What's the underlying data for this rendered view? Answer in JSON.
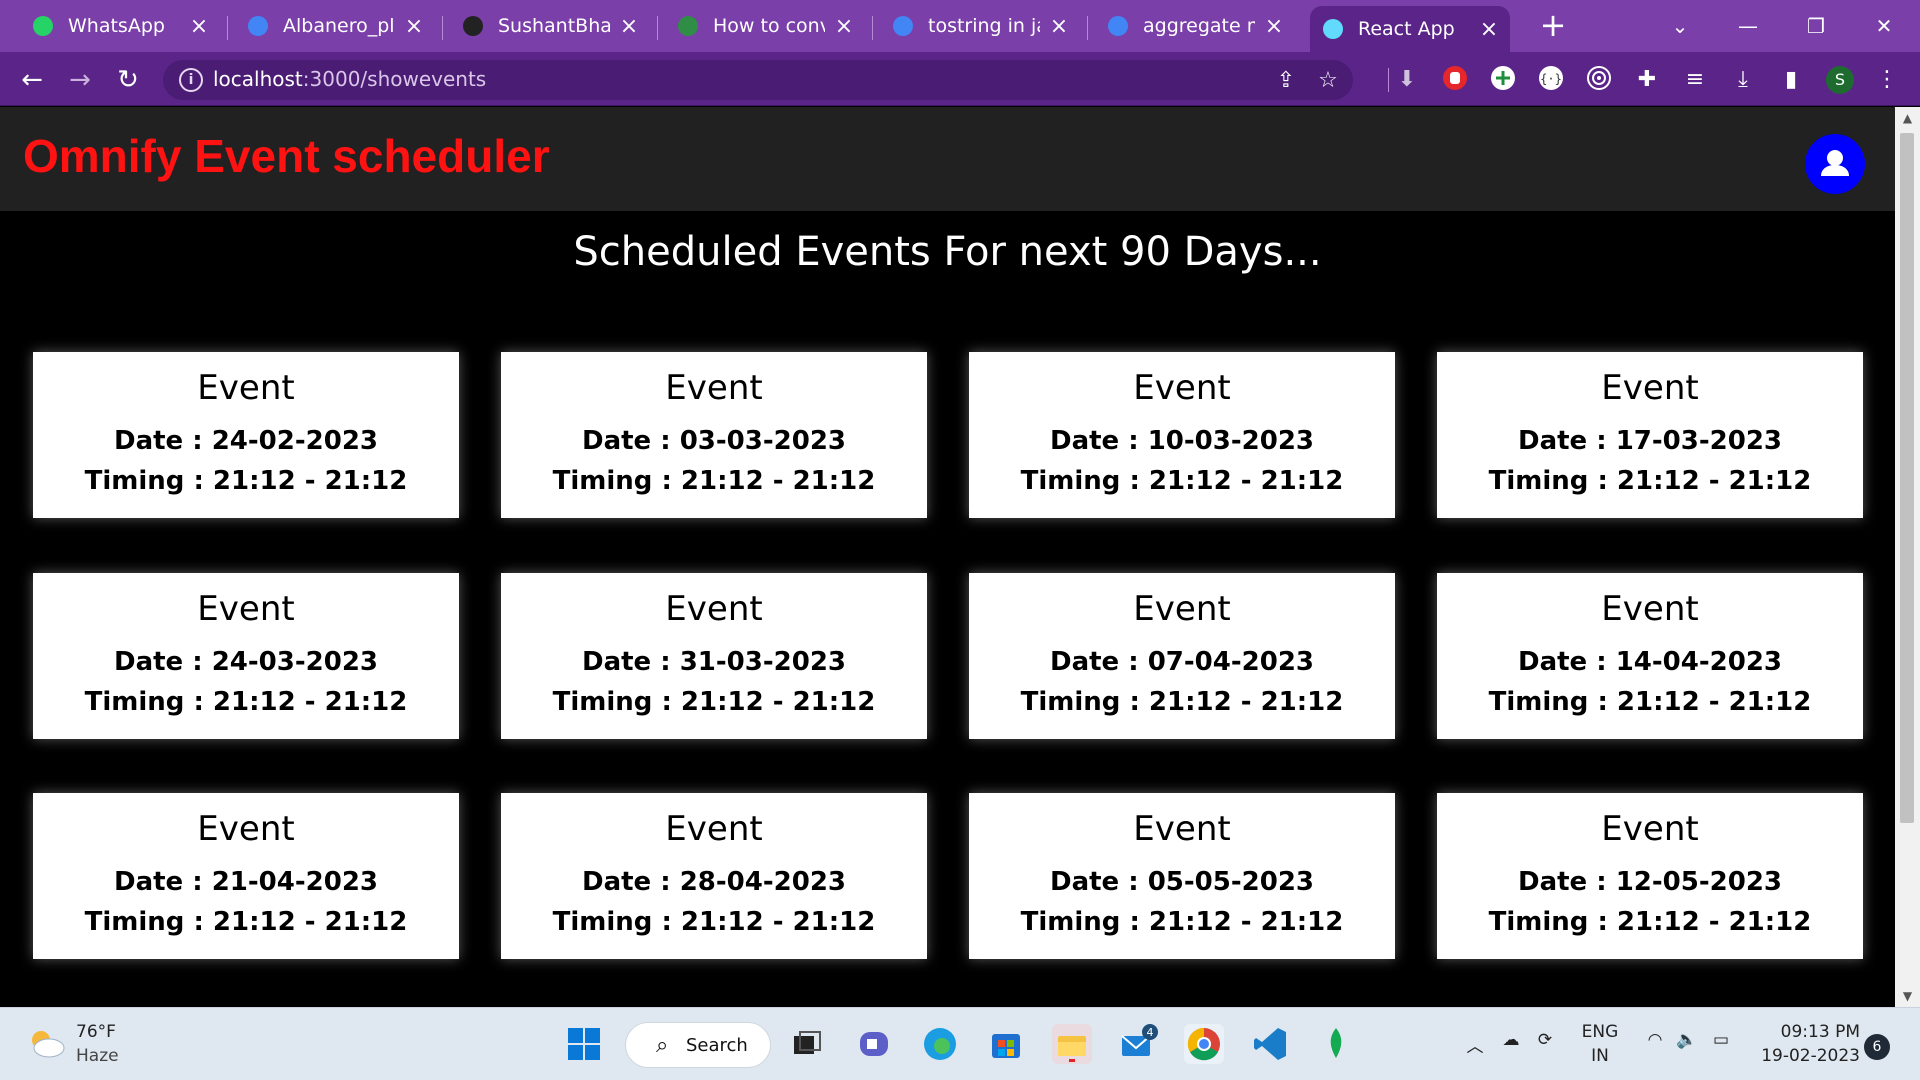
{
  "browser": {
    "tabs": [
      {
        "title": "WhatsApp",
        "icon": "whatsapp-icon",
        "color": "#25d366"
      },
      {
        "title": "Albanero_playb",
        "icon": "docs-icon",
        "color": "#4285f4"
      },
      {
        "title": "SushantBhaisw",
        "icon": "github-icon",
        "color": "#222222"
      },
      {
        "title": "How to conver",
        "icon": "geeksforgeeks-icon",
        "color": "#2f8d46"
      },
      {
        "title": "tostring in java",
        "icon": "google-icon",
        "color": "#4285f4"
      },
      {
        "title": "aggregate mor",
        "icon": "google-icon",
        "color": "#4285f4"
      },
      {
        "title": "React App",
        "icon": "react-icon",
        "color": "#61dafb"
      }
    ],
    "active_tab": 6,
    "url_host": "localhost",
    "url_path": ":3000/showevents"
  },
  "app": {
    "title": "Omnify Event scheduler",
    "heading": "Scheduled Events For next 90 Days...",
    "events": [
      {
        "title": "Event",
        "date": "Date : 24-02-2023",
        "timing": "Timing : 21:12 - 21:12"
      },
      {
        "title": "Event",
        "date": "Date : 03-03-2023",
        "timing": "Timing : 21:12 - 21:12"
      },
      {
        "title": "Event",
        "date": "Date : 10-03-2023",
        "timing": "Timing : 21:12 - 21:12"
      },
      {
        "title": "Event",
        "date": "Date : 17-03-2023",
        "timing": "Timing : 21:12 - 21:12"
      },
      {
        "title": "Event",
        "date": "Date : 24-03-2023",
        "timing": "Timing : 21:12 - 21:12"
      },
      {
        "title": "Event",
        "date": "Date : 31-03-2023",
        "timing": "Timing : 21:12 - 21:12"
      },
      {
        "title": "Event",
        "date": "Date : 07-04-2023",
        "timing": "Timing : 21:12 - 21:12"
      },
      {
        "title": "Event",
        "date": "Date : 14-04-2023",
        "timing": "Timing : 21:12 - 21:12"
      },
      {
        "title": "Event",
        "date": "Date : 21-04-2023",
        "timing": "Timing : 21:12 - 21:12"
      },
      {
        "title": "Event",
        "date": "Date : 28-04-2023",
        "timing": "Timing : 21:12 - 21:12"
      },
      {
        "title": "Event",
        "date": "Date : 05-05-2023",
        "timing": "Timing : 21:12 - 21:12"
      },
      {
        "title": "Event",
        "date": "Date : 12-05-2023",
        "timing": "Timing : 21:12 - 21:12"
      }
    ]
  },
  "taskbar": {
    "weather_temp": "76°F",
    "weather_cond": "Haze",
    "search_label": "Search",
    "mail_badge": "4",
    "lang_top": "ENG",
    "lang_bottom": "IN",
    "time": "09:13 PM",
    "date": "19-02-2023",
    "notifications": "6",
    "profile_initial": "S"
  },
  "colors": {
    "tabbar": "#7a3fa8",
    "toolbar": "#5b2488",
    "app_title": "#ff1212",
    "avatar": "#0000ff"
  }
}
